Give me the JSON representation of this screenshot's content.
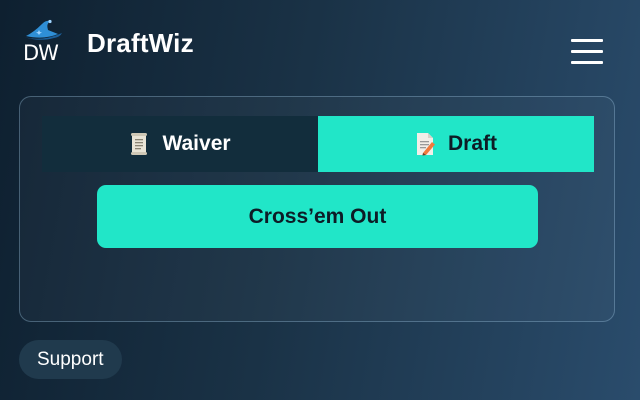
{
  "app": {
    "logo_text": "DW",
    "title": "DraftWiz",
    "menu_icon": "hamburger-menu-icon"
  },
  "tabs": [
    {
      "label": "Waiver",
      "icon": "scroll-document-icon",
      "active": false
    },
    {
      "label": "Draft",
      "icon": "pencil-document-icon",
      "active": true
    }
  ],
  "primary_action": {
    "label": "Cross’em Out"
  },
  "footer": {
    "support_label": "Support"
  },
  "colors": {
    "accent": "#21e6c8",
    "inactive_tab": "#122d3c",
    "background_start": "#0e2030",
    "background_end": "#2a4c6c",
    "support_pill": "#203a4d",
    "dark_text": "#0d1c26"
  }
}
